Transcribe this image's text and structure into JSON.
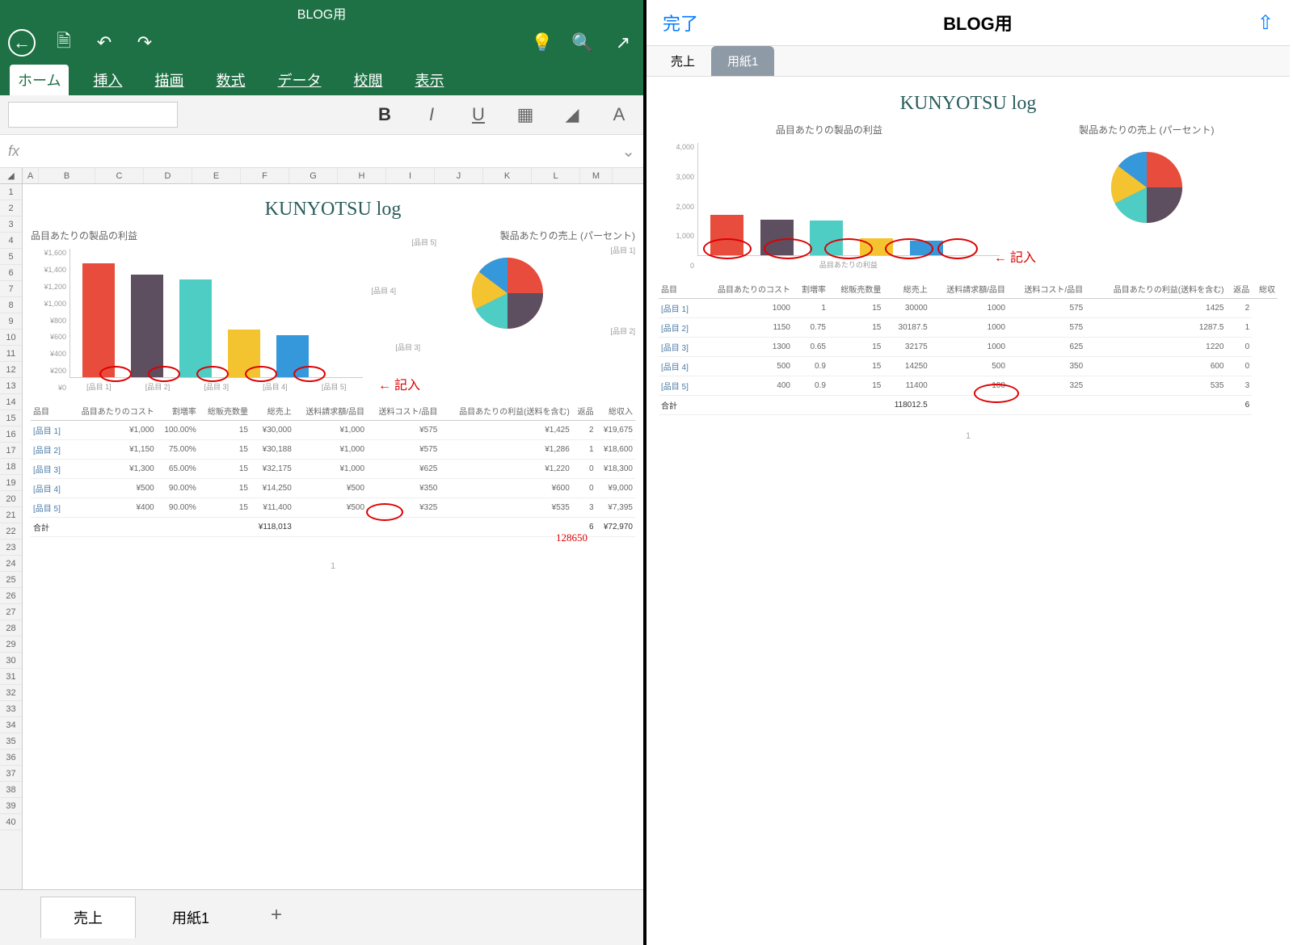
{
  "left": {
    "app_title": "BLOG用",
    "ribbon_tabs": [
      "ホーム",
      "挿入",
      "描画",
      "数式",
      "データ",
      "校閲",
      "表示"
    ],
    "active_ribbon": "ホーム",
    "sheet_tabs": [
      "売上",
      "用紙1"
    ],
    "active_sheet": "売上",
    "add_sheet": "+",
    "columns": [
      "A",
      "B",
      "C",
      "D",
      "E",
      "F",
      "G",
      "H",
      "I",
      "J",
      "K",
      "L",
      "M"
    ],
    "doc_title": "KUNYOTSU log",
    "chart1_title": "品目あたりの製品の利益",
    "chart2_title": "製品あたりの売上 (パーセント)",
    "table_headers": [
      "品目",
      "品目あたりのコスト",
      "割増率",
      "総販売数量",
      "総売上",
      "送料請求額/品目",
      "送料コスト/品目",
      "品目あたりの利益(送料を含む)",
      "返品",
      "総収入"
    ],
    "rows": [
      {
        "h": "[品目 1]",
        "v": [
          "¥1,000",
          "100.00%",
          "15",
          "¥30,000",
          "¥1,000",
          "¥575",
          "¥1,425",
          "2",
          "¥19,675"
        ]
      },
      {
        "h": "[品目 2]",
        "v": [
          "¥1,150",
          "75.00%",
          "15",
          "¥30,188",
          "¥1,000",
          "¥575",
          "¥1,286",
          "1",
          "¥18,600"
        ]
      },
      {
        "h": "[品目 3]",
        "v": [
          "¥1,300",
          "65.00%",
          "15",
          "¥32,175",
          "¥1,000",
          "¥625",
          "¥1,220",
          "0",
          "¥18,300"
        ]
      },
      {
        "h": "[品目 4]",
        "v": [
          "¥500",
          "90.00%",
          "15",
          "¥14,250",
          "¥500",
          "¥350",
          "¥600",
          "0",
          "¥9,000"
        ]
      },
      {
        "h": "[品目 5]",
        "v": [
          "¥400",
          "90.00%",
          "15",
          "¥11,400",
          "¥500",
          "¥325",
          "¥535",
          "3",
          "¥7,395"
        ]
      }
    ],
    "total": {
      "h": "合計",
      "total_sales": "¥118,013",
      "returns": "6",
      "total_rev": "¥72,970"
    },
    "annotation_text": "記入",
    "hand_number": "128650",
    "page_num": "1",
    "y_ticks": [
      "¥1,600",
      "¥1,400",
      "¥1,200",
      "¥1,000",
      "¥800",
      "¥600",
      "¥400",
      "¥200",
      "¥0"
    ],
    "x_ticks": [
      "[品目 1]",
      "[品目 2]",
      "[品目 3]",
      "[品目 4]",
      "[品目 5]"
    ],
    "pie_labels": [
      "[品目 1]",
      "[品目 2]",
      "[品目 3]",
      "[品目 4]",
      "[品目 5]"
    ]
  },
  "right": {
    "done": "完了",
    "title": "BLOG用",
    "tabs": [
      "売上",
      "用紙1"
    ],
    "active_tab": "用紙1",
    "doc_title": "KUNYOTSU log",
    "chart1_title": "品目あたりの製品の利益",
    "chart2_title": "製品あたりの売上 (パーセント)",
    "sub_label": "品目あたりの利益",
    "y_ticks": [
      "4,000",
      "3,000",
      "2,000",
      "1,000",
      "0"
    ],
    "table_headers": [
      "品目",
      "品目あたりのコスト",
      "割増率",
      "総販売数量",
      "総売上",
      "送料請求額/品目",
      "送料コスト/品目",
      "品目あたりの利益(送料を含む)",
      "返品",
      "総収"
    ],
    "rows": [
      {
        "h": "[品目 1]",
        "v": [
          "1000",
          "1",
          "15",
          "30000",
          "1000",
          "575",
          "1425",
          "2"
        ]
      },
      {
        "h": "[品目 2]",
        "v": [
          "1150",
          "0.75",
          "15",
          "30187.5",
          "1000",
          "575",
          "1287.5",
          "1"
        ]
      },
      {
        "h": "[品目 3]",
        "v": [
          "1300",
          "0.65",
          "15",
          "32175",
          "1000",
          "625",
          "1220",
          "0"
        ]
      },
      {
        "h": "[品目 4]",
        "v": [
          "500",
          "0.9",
          "15",
          "14250",
          "500",
          "350",
          "600",
          "0"
        ]
      },
      {
        "h": "[品目 5]",
        "v": [
          "400",
          "0.9",
          "15",
          "11400",
          "100",
          "325",
          "535",
          "3"
        ]
      }
    ],
    "total": {
      "h": "合計",
      "total_sales": "118012.5",
      "returns": "6"
    },
    "annotation_text": "記入",
    "page_num": "1"
  },
  "chart_data": [
    {
      "type": "bar",
      "title": "品目あたりの製品の利益",
      "categories": [
        "[品目 1]",
        "[品目 2]",
        "[品目 3]",
        "[品目 4]",
        "[品目 5]"
      ],
      "values": [
        1425,
        1286,
        1220,
        600,
        535
      ],
      "ylim": [
        0,
        1600
      ],
      "ylabel": "",
      "xlabel": ""
    },
    {
      "type": "pie",
      "title": "製品あたりの売上 (パーセント)",
      "categories": [
        "[品目 1]",
        "[品目 2]",
        "[品目 3]",
        "[品目 4]",
        "[品目 5]"
      ],
      "values": [
        30000,
        30188,
        32175,
        14250,
        11400
      ]
    },
    {
      "type": "bar",
      "title": "品目あたりの製品の利益 (右)",
      "categories": [
        "[品目 1]",
        "[品目 2]",
        "[品目 3]",
        "[品目 4]",
        "[品目 5]"
      ],
      "values": [
        1425,
        1287.5,
        1220,
        600,
        535
      ],
      "ylim": [
        0,
        4000
      ]
    }
  ],
  "colors": {
    "c1": "#e74c3c",
    "c2": "#5d4e60",
    "c3": "#4ecdc4",
    "c4": "#f4c430",
    "c5": "#3498db"
  }
}
